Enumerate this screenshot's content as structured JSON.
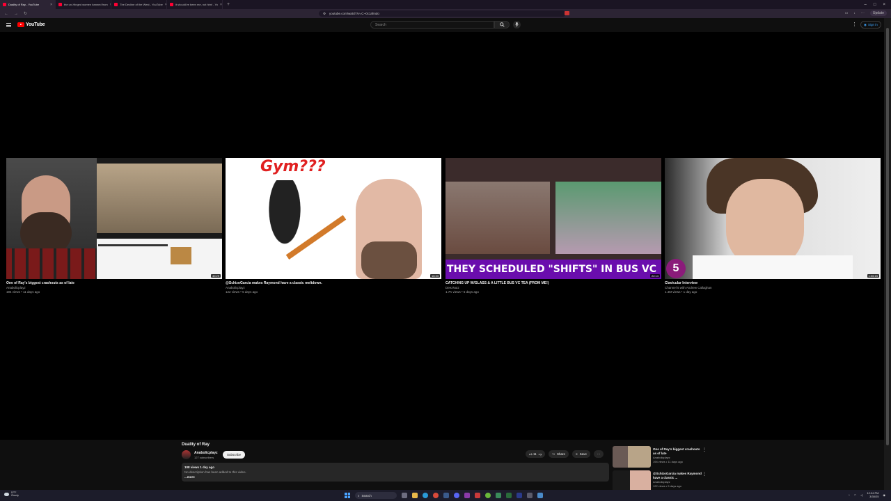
{
  "browser": {
    "tabs": [
      {
        "label": "Duality of Ray - YouTube",
        "active": true
      },
      {
        "label": "the un-Hinged women banned from",
        "active": false
      },
      {
        "label": "The Decline of the West - YouTube",
        "active": false
      },
      {
        "label": "it should've been me, not him! - Yo",
        "active": false
      }
    ],
    "url": "youtube.com/watch?v=C~0c1ahndo",
    "update_label": "Update"
  },
  "header": {
    "logo_text": "YouTube",
    "search_placeholder": "Search",
    "signin_label": "Sign in"
  },
  "end_screen": [
    {
      "title": "One of Ray's biggest crashouts as of late",
      "channel": "Anabolicplayz",
      "meta": "194 views • 11 days ago",
      "duration": "40:29"
    },
    {
      "title": "@SchizoGarcia makes Raymond have a classic meltdown.",
      "channel": "Anabolicplayz",
      "meta": "122 views • 5 days ago",
      "duration": "16:33",
      "overlay_text": "Gym???"
    },
    {
      "title": "CATCHING UP W/GLASS & A LITTLE BUS VC TEA (FROM ME!)",
      "channel": "DeezNutz",
      "meta": "1.7K views • 5 days ago",
      "duration": "22:14",
      "banner_text": "THEY SCHEDULED \"SHIFTS\" IN BUS VC"
    },
    {
      "title": "Clavicular Interview",
      "channel": "Channel 5 with Andrew Callaghan",
      "meta": "1.4M views • 1 day ago",
      "duration": "1:06:15",
      "badge": "5"
    }
  ],
  "video": {
    "title": "Duality of Ray",
    "channel": "Anabolicplayz",
    "subscribers": "127 subscribers",
    "subscribe_label": "Subscribe",
    "likes": "11",
    "share_label": "Share",
    "save_label": "Save",
    "views_date": "108 views  1 day ago",
    "description": "No description has been added to this video.",
    "more_label": "...more"
  },
  "sidebar": [
    {
      "title": "One of Ray's biggest crashouts as of late",
      "channel": "Anabolicplayz",
      "meta": "194 views • 11 days ago"
    },
    {
      "title": "@SchizoGarcia makes Raymond have a classic ...",
      "channel": "Anabolicplayz",
      "meta": "122 views • 5 days ago"
    }
  ],
  "taskbar": {
    "weather_temp": "57°F",
    "weather_desc": "Cloudy",
    "search_label": "Search",
    "time": "12:24 PM",
    "date": "3/30/25"
  },
  "colors": {
    "youtube_red": "#ff0000",
    "banner_purple": "#6a0dad",
    "link_blue": "#3ea6ff"
  }
}
